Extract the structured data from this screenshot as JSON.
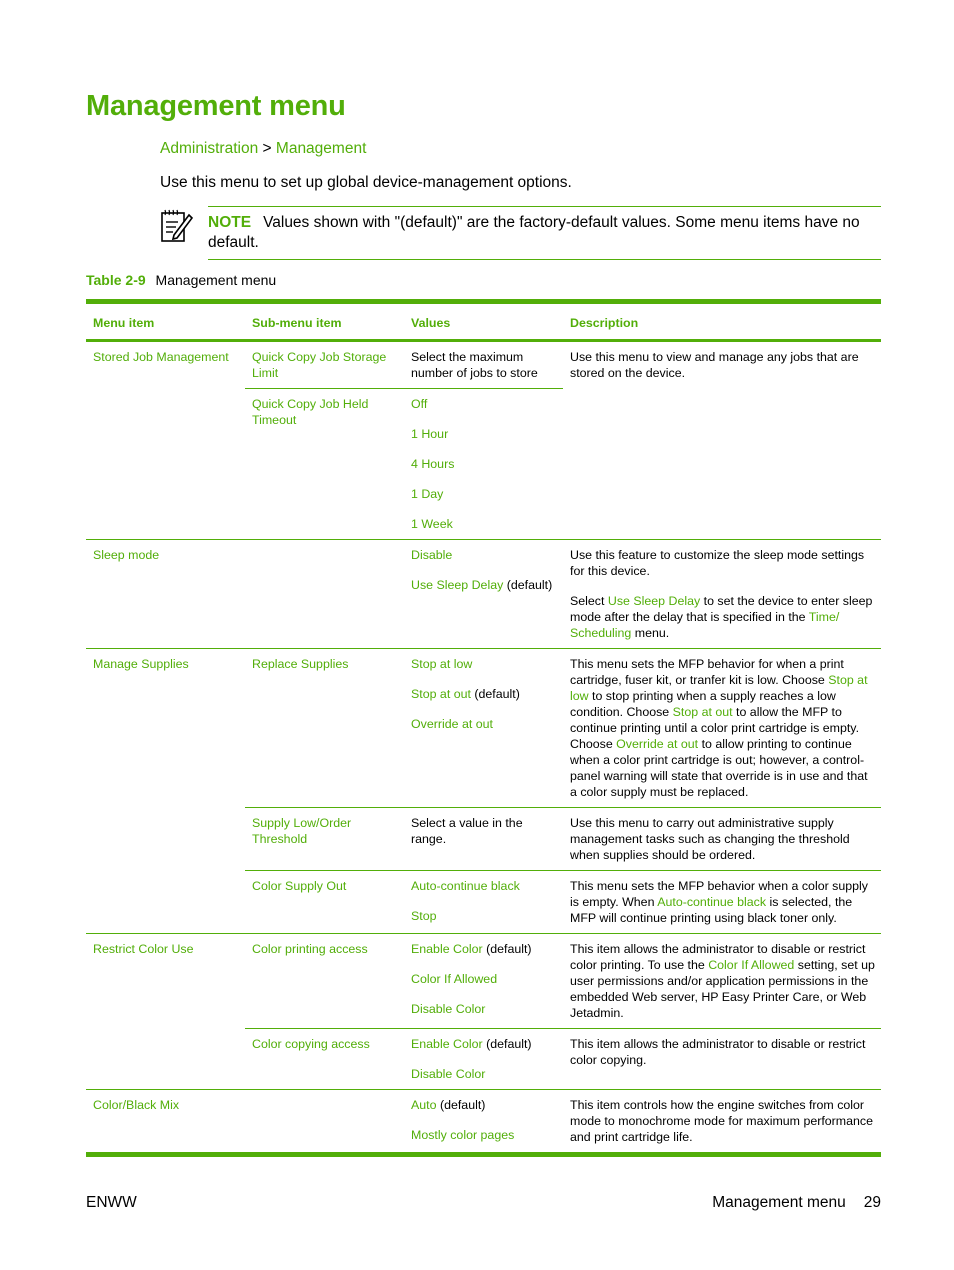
{
  "page": {
    "title": "Management menu",
    "breadcrumb": {
      "parent": "Administration",
      "separator": ">",
      "current": "Management"
    },
    "intro": "Use this menu to set up global device-management options.",
    "note": {
      "icon": "note-pencil-icon",
      "label": "NOTE",
      "text": "Values shown with \"(default)\" are the factory-default values. Some menu items have no default."
    },
    "caption": {
      "number": "Table 2-9",
      "title": "Management menu"
    },
    "accent_color": "#52ae09",
    "footer": {
      "left": "ENWW",
      "section": "Management menu",
      "page_number": "29"
    }
  },
  "table": {
    "headers": [
      "Menu item",
      "Sub-menu item",
      "Values",
      "Description"
    ],
    "rows": {
      "stored_job": {
        "menu": "Stored Job Management",
        "sub1": {
          "name": "Quick Copy Job Storage Limit",
          "values_text": "Select the maximum number of jobs to store"
        },
        "sub2": {
          "name": "Quick Copy Job Held Timeout",
          "values": [
            "Off",
            "1 Hour",
            "4 Hours",
            "1 Day",
            "1 Week"
          ]
        },
        "description": "Use this menu to view and manage any jobs that are stored on the device."
      },
      "sleep": {
        "menu": "Sleep mode",
        "values": [
          "Disable",
          "Use Sleep Delay"
        ],
        "default_suffix": "(default)",
        "desc1": "Use this feature to customize the sleep mode settings for this device.",
        "desc2": {
          "a": "Select ",
          "l1": "Use Sleep Delay",
          "b": " to set the device to enter sleep mode after the delay that is specified in the ",
          "l2": "Time/ Scheduling",
          "c": " menu."
        }
      },
      "supplies": {
        "menu": "Manage Supplies",
        "replace": {
          "name": "Replace Supplies",
          "values": [
            "Stop at low",
            "Stop at out",
            "Override at out"
          ],
          "default_suffix": "(default)",
          "desc": {
            "a": "This menu sets the MFP behavior for when a print cartridge, fuser kit, or tranfer kit is low. Choose ",
            "l1": "Stop at low",
            "b": " to stop printing when a supply reaches a low condition. Choose ",
            "l2": "Stop at out",
            "c": " to allow the MFP to continue printing until a color print cartridge is empty. Choose ",
            "l3": "Override at out",
            "d": " to allow printing to continue when a color print cartridge is out; however, a control-panel warning will state that override is in use and that a color supply must be replaced."
          }
        },
        "threshold": {
          "name": "Supply Low/Order Threshold",
          "values_text": "Select a value in the range.",
          "desc": "Use this menu to carry out administrative supply management tasks such as changing the threshold when supplies should be ordered."
        },
        "color_out": {
          "name": "Color Supply Out",
          "values": [
            "Auto-continue black",
            "Stop"
          ],
          "desc": {
            "a": "This menu sets the MFP behavior when a color supply is empty. When ",
            "l1": "Auto-continue black",
            "b": " is selected, the MFP will continue printing using black toner only."
          }
        }
      },
      "restrict": {
        "menu": "Restrict Color Use",
        "printing": {
          "name": "Color printing access",
          "values": [
            "Enable Color",
            "Color If Allowed",
            "Disable Color"
          ],
          "default_suffix": "(default)",
          "desc": {
            "a": "This item allows the administrator to disable or restrict color printing. To use the ",
            "l1": "Color If Allowed",
            "b": " setting, set up user permissions and/or application permissions in the embedded Web server, HP Easy Printer Care, or Web Jetadmin."
          }
        },
        "copying": {
          "name": "Color copying access",
          "values": [
            "Enable Color",
            "Disable Color"
          ],
          "default_suffix": "(default)",
          "desc": "This item allows the administrator to disable or restrict color copying."
        }
      },
      "mix": {
        "menu": "Color/Black Mix",
        "values": [
          "Auto",
          "Mostly color pages"
        ],
        "default_suffix": "(default)",
        "desc": "This item controls how the engine switches from color mode to monochrome mode for maximum performance and print cartridge life."
      }
    }
  }
}
